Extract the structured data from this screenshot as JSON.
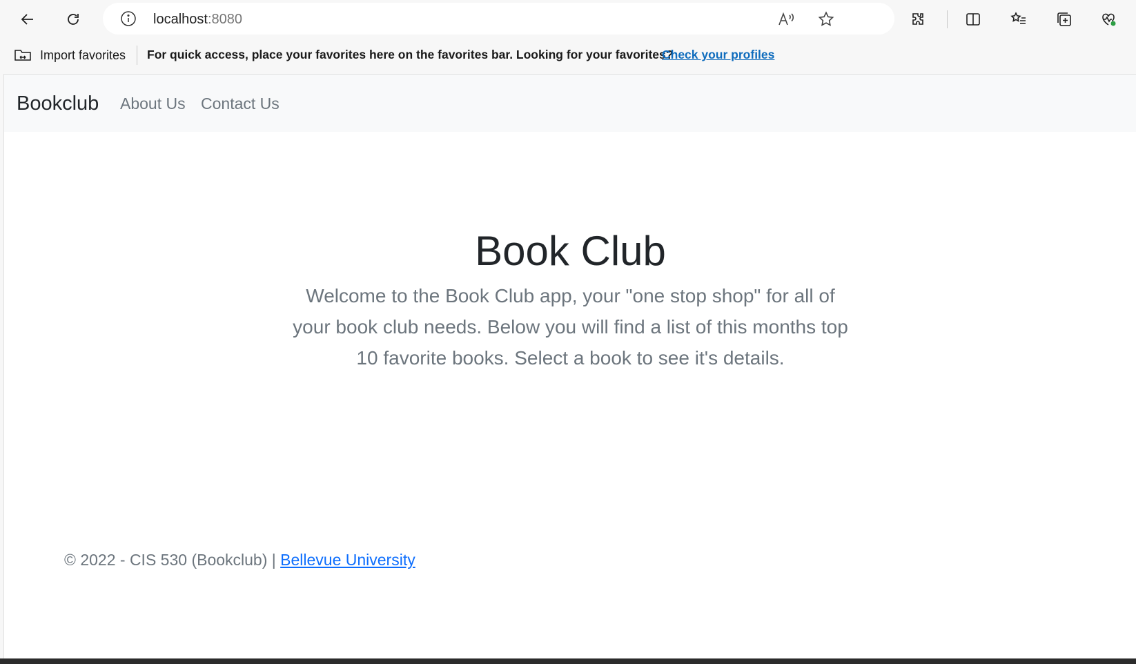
{
  "browser": {
    "url_host": "localhost",
    "url_port": ":8080"
  },
  "favorites_bar": {
    "import_label": "Import favorites",
    "message": "For quick access, place your favorites here on the favorites bar. Looking for your favorites?",
    "link_label": "Check your profiles"
  },
  "navbar": {
    "brand": "Bookclub",
    "links": [
      "About Us",
      "Contact Us"
    ]
  },
  "hero": {
    "title": "Book Club",
    "lead": "Welcome to the Book Club app, your \"one stop shop\" for all of your book club needs. Below you will find a list of this months top 10 favorite books. Select a book to see it's details."
  },
  "footer": {
    "text": "© 2022 - CIS 530 (Bookclub) | ",
    "link": "Bellevue University"
  }
}
